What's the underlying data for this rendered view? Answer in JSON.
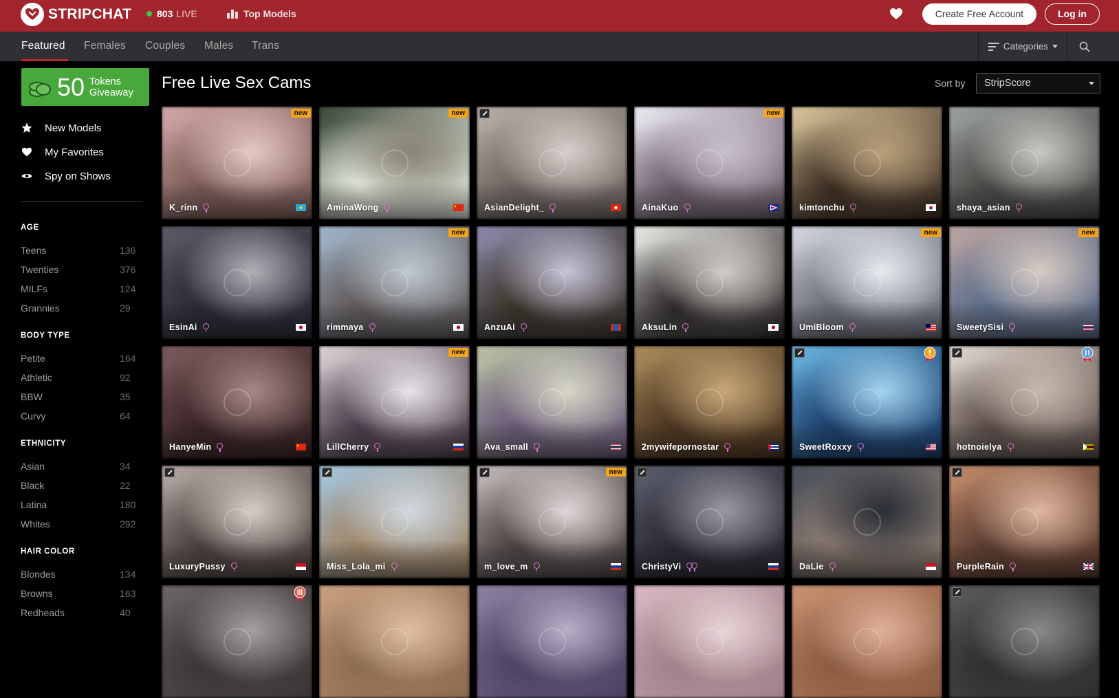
{
  "header": {
    "logo_text": "STRIPCHAT",
    "live_count": "803",
    "live_label": "LIVE",
    "top_models": "Top Models",
    "create_account": "Create Free Account",
    "login": "Log in"
  },
  "nav": {
    "tabs": [
      {
        "label": "Featured",
        "active": true
      },
      {
        "label": "Females"
      },
      {
        "label": "Couples"
      },
      {
        "label": "Males"
      },
      {
        "label": "Trans"
      }
    ],
    "categories": "Categories"
  },
  "sidebar": {
    "giveaway": {
      "number": "50",
      "line1": "Tokens",
      "line2": "Giveaway"
    },
    "links": [
      {
        "label": "New Models",
        "icon": "star-icon"
      },
      {
        "label": "My Favorites",
        "icon": "heart-icon"
      },
      {
        "label": "Spy on Shows",
        "icon": "eye-icon"
      }
    ],
    "sections": [
      {
        "title": "AGE",
        "items": [
          {
            "label": "Teens",
            "count": "136"
          },
          {
            "label": "Twenties",
            "count": "376"
          },
          {
            "label": "MILFs",
            "count": "124"
          },
          {
            "label": "Grannies",
            "count": "29"
          }
        ]
      },
      {
        "title": "BODY TYPE",
        "items": [
          {
            "label": "Petite",
            "count": "164"
          },
          {
            "label": "Athletic",
            "count": "92"
          },
          {
            "label": "BBW",
            "count": "35"
          },
          {
            "label": "Curvy",
            "count": "64"
          }
        ]
      },
      {
        "title": "ETHNICITY",
        "items": [
          {
            "label": "Asian",
            "count": "34"
          },
          {
            "label": "Black",
            "count": "22"
          },
          {
            "label": "Latina",
            "count": "180"
          },
          {
            "label": "Whites",
            "count": "292"
          }
        ]
      },
      {
        "title": "HAIR COLOR",
        "items": [
          {
            "label": "Blondes",
            "count": "134"
          },
          {
            "label": "Browns",
            "count": "163"
          },
          {
            "label": "Redheads",
            "count": "40"
          }
        ]
      }
    ]
  },
  "main": {
    "title": "Free Live Sex Cams",
    "sort_label": "Sort by",
    "sort_value": "StripScore",
    "badge_new": "new",
    "cards": [
      {
        "name": "K_rinn",
        "badge": "new",
        "flag": "kz",
        "bg": [
          "#cfa6a6",
          "#7a5a55",
          "#e6c8c4"
        ]
      },
      {
        "name": "AminaWong",
        "badge": "new",
        "flag": "cn",
        "bg": [
          "#3c4a3a",
          "#e8ebe0",
          "#8a8474"
        ]
      },
      {
        "name": "AsianDelight_",
        "badge": "hd",
        "flag": "hk",
        "bg": [
          "#b8aea8",
          "#6e6460",
          "#d8d0cc"
        ]
      },
      {
        "name": "AinaKuo",
        "badge": "new",
        "flag": "us-territory",
        "bg": [
          "#eae8f0",
          "#6a5a68",
          "#c8c0cc"
        ]
      },
      {
        "name": "kimtonchu",
        "flag": "kr",
        "bg": [
          "#d8c49a",
          "#3a2a20",
          "#b8a07a"
        ]
      },
      {
        "name": "shaya_asian",
        "flag": "",
        "bg": [
          "#9aa09c",
          "#4a4846",
          "#c8c8c4"
        ]
      },
      {
        "name": "EsinAi",
        "flag": "jp",
        "bg": [
          "#5a5a66",
          "#2a2a36",
          "#b4b0b8"
        ]
      },
      {
        "name": "rimmaya",
        "badge": "new",
        "flag": "jp",
        "bg": [
          "#a0b4c8",
          "#605858",
          "#c0c8d0"
        ]
      },
      {
        "name": "AnzuAi",
        "flag": "mn",
        "bg": [
          "#8a88a8",
          "#3a3428",
          "#c8c4d8"
        ]
      },
      {
        "name": "AksuLin",
        "flag": "jp",
        "bg": [
          "#e8e8e4",
          "#2a2626",
          "#d0ccc8"
        ]
      },
      {
        "name": "UmiBloom",
        "badge": "new",
        "flag": "my",
        "bg": [
          "#d0d4dc",
          "#6a6c78",
          "#e8eaf0"
        ]
      },
      {
        "name": "SweetySisi",
        "badge": "new",
        "flag": "th",
        "bg": [
          "#b8a4a0",
          "#5a6c8a",
          "#d8ccc4"
        ]
      },
      {
        "name": "HanyeMin",
        "flag": "cn",
        "bg": [
          "#7a5a5c",
          "#3a2426",
          "#a88888"
        ]
      },
      {
        "name": "LillCherry",
        "badge": "new",
        "flag": "ru",
        "bg": [
          "#d8d0d4",
          "#4a3a48",
          "#e8e4e8"
        ]
      },
      {
        "name": "Ava_small",
        "flag": "th",
        "bg": [
          "#b8c0a4",
          "#6a5a7a",
          "#d8d8c8"
        ]
      },
      {
        "name": "2mywifepornostar",
        "flag": "cu",
        "bg": [
          "#a88a5a",
          "#4a3420",
          "#c8a878"
        ]
      },
      {
        "name": "SweetRoxxy",
        "badge": "hd",
        "ribbon": "gold",
        "flag": "us",
        "bg": [
          "#6ab4e0",
          "#1a3c6a",
          "#a4d4f0"
        ]
      },
      {
        "name": "hotnoielya",
        "badge": "hd",
        "ribbon": "blue",
        "flag": "zw",
        "bg": [
          "#e0d8d0",
          "#5a4c48",
          "#c8b8ac"
        ]
      },
      {
        "name": "LuxuryPussy",
        "badge": "hd",
        "flag": "id",
        "bg": [
          "#b4a8a4",
          "#4a3e3c",
          "#d8ccc8"
        ]
      },
      {
        "name": "Miss_Lola_mi",
        "badge": "hd",
        "flag": "",
        "bg": [
          "#a4c4dc",
          "#a08464",
          "#d0d8e0"
        ]
      },
      {
        "name": "m_love_m",
        "badge": "hd",
        "badge2": "new",
        "flag": "ru",
        "bg": [
          "#c0b8b8",
          "#4a4040",
          "#e0d8d8"
        ]
      },
      {
        "name": "ChristyVi",
        "badge": "hd",
        "gender": "couple",
        "flag": "ru",
        "bg": [
          "#5a5c6a",
          "#2a2a34",
          "#9a9aa4"
        ]
      },
      {
        "name": "DaLie",
        "flag": "id",
        "bg": [
          "#4a505a",
          "#8a7a70",
          "#2a2e36"
        ]
      },
      {
        "name": "PurpleRain",
        "badge": "hd",
        "flag": "gb",
        "bg": [
          "#c08a6a",
          "#5a3c30",
          "#e0b8a0"
        ]
      },
      {
        "name": "",
        "ribbon": "red",
        "flag": "",
        "bg": [
          "#6a6464",
          "#3a3434",
          "#a8a0a0"
        ]
      },
      {
        "name": "",
        "flag": "",
        "bg": [
          "#c8a080",
          "#8a6a50",
          "#e0c0a0"
        ]
      },
      {
        "name": "",
        "flag": "",
        "bg": [
          "#8a80a0",
          "#4a4060",
          "#b8b0c8"
        ]
      },
      {
        "name": "",
        "flag": "",
        "bg": [
          "#d8b8c0",
          "#a08088",
          "#e8d4d8"
        ]
      },
      {
        "name": "",
        "flag": "",
        "bg": [
          "#c89070",
          "#8a5a40",
          "#e0b098"
        ]
      },
      {
        "name": "",
        "badge": "hd",
        "flag": "",
        "bg": [
          "#5a5a5a",
          "#2e2e2e",
          "#8a8a8a"
        ]
      }
    ]
  },
  "colors": {
    "header": "#a2252d",
    "nav": "#2f3033",
    "giveaway": "#49a83b",
    "new_badge": "#f3a31a"
  }
}
